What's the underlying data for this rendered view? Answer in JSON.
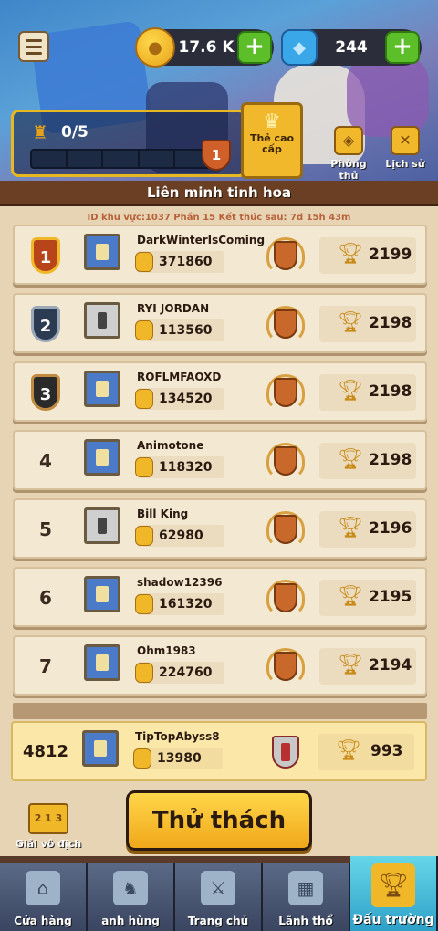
{
  "resources": {
    "gold": "17.6 K",
    "gems": "244",
    "plus_label": "+"
  },
  "pass": {
    "progress": "0/5",
    "progress_fraction": 0,
    "level": "1",
    "premium_button": "Thẻ cao cấp"
  },
  "side_buttons": {
    "defense": "Phòng thủ",
    "history": "Lịch sử"
  },
  "board": {
    "title": "Liên minh tinh hoa",
    "info": "ID khu vực:1037  Phần 15 Kết thúc sau: 7d 15h 43m"
  },
  "leaderboard": [
    {
      "rank": "1",
      "name": "DarkWinterIsComing",
      "power": "371860",
      "trophies": "2199"
    },
    {
      "rank": "2",
      "name": "RYI JORDAN",
      "power": "113560",
      "trophies": "2198"
    },
    {
      "rank": "3",
      "name": "ROFLMFAOXD",
      "power": "134520",
      "trophies": "2198"
    },
    {
      "rank": "4",
      "name": "Animotone",
      "power": "118320",
      "trophies": "2198"
    },
    {
      "rank": "5",
      "name": "Bill King",
      "power": "62980",
      "trophies": "2196"
    },
    {
      "rank": "6",
      "name": "shadow12396",
      "power": "161320",
      "trophies": "2195"
    },
    {
      "rank": "7",
      "name": "Ohm1983",
      "power": "224760",
      "trophies": "2194"
    }
  ],
  "me": {
    "rank": "4812",
    "name": "TipTopAbyss8",
    "power": "13980",
    "trophies": "993"
  },
  "champion_button": "Giải vô địch",
  "challenge_button": "Thử thách",
  "nav": [
    {
      "label": "Cửa hàng",
      "icon": "shop-icon"
    },
    {
      "label": "anh hùng",
      "icon": "hero-icon"
    },
    {
      "label": "Trang chủ",
      "icon": "swords-icon"
    },
    {
      "label": "Lãnh thổ",
      "icon": "map-icon"
    },
    {
      "label": "Đấu trường",
      "icon": "trophy-icon"
    }
  ],
  "colors": {
    "accent_gold": "#f0b828",
    "plus_green": "#5cbf2a",
    "active_tab": "#2ea0c8"
  }
}
